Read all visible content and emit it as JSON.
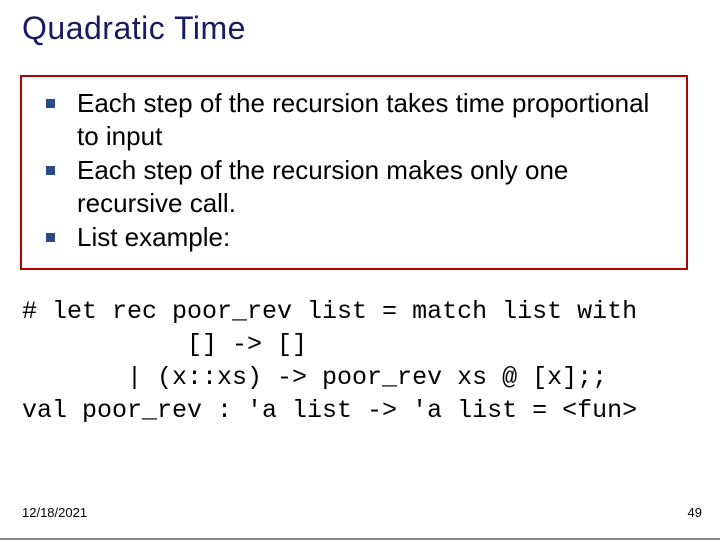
{
  "title": "Quadratic Time",
  "bullets": [
    "Each step of the recursion takes time proportional to input",
    "Each step of the recursion makes only one recursive call.",
    "List example:"
  ],
  "code": {
    "l1": "# let rec poor_rev list = match list with",
    "l2": "           [] -> []",
    "l3": "       | (x::xs) -> poor_rev xs @ [x];;",
    "l4": "val poor_rev : 'a list -> 'a list = <fun>"
  },
  "footer": {
    "date": "12/18/2021",
    "page": "49"
  }
}
